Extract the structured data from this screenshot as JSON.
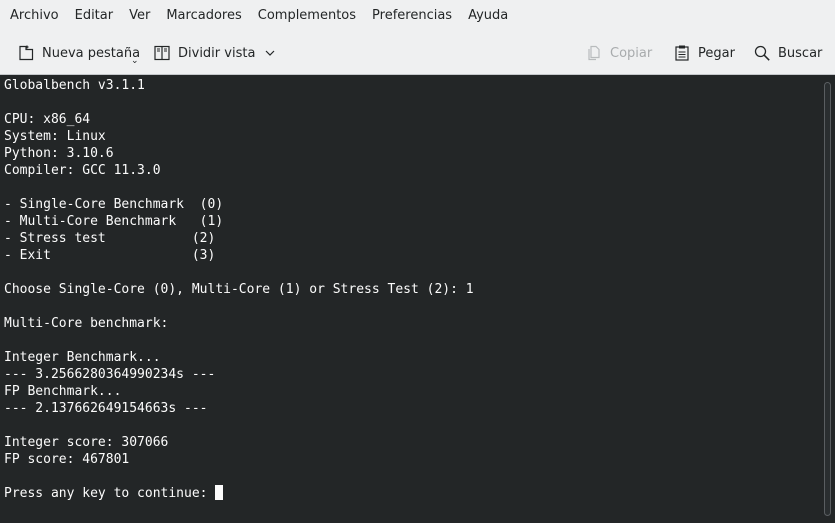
{
  "menubar": {
    "items": [
      "Archivo",
      "Editar",
      "Ver",
      "Marcadores",
      "Complementos",
      "Preferencias",
      "Ayuda"
    ]
  },
  "toolbar": {
    "new_tab_label": "Nueva pestaña",
    "split_view_label": "Dividir vista",
    "copy_label": "Copiar",
    "paste_label": "Pegar",
    "find_label": "Buscar",
    "icons": {
      "new_tab": "new-tab-icon",
      "split_view": "split-view-icon",
      "copy": "copy-icon",
      "paste": "paste-icon",
      "find": "search-icon"
    }
  },
  "terminal": {
    "lines": [
      "Globalbench v3.1.1",
      "",
      "CPU: x86_64",
      "System: Linux",
      "Python: 3.10.6",
      "Compiler: GCC 11.3.0",
      "",
      "- Single-Core Benchmark  (0)",
      "- Multi-Core Benchmark   (1)",
      "- Stress test           (2)",
      "- Exit                  (3)",
      "",
      "Choose Single-Core (0), Multi-Core (1) or Stress Test (2): 1",
      "",
      "Multi-Core benchmark:",
      "",
      "Integer Benchmark...",
      "--- 3.2566280364990234s ---",
      "FP Benchmark...",
      "--- 2.137662649154663s ---",
      "",
      "Integer score: 307066",
      "FP score: 467801",
      ""
    ],
    "prompt": "Press any key to continue: "
  },
  "colors": {
    "chrome_bg": "#eff0f1",
    "terminal_bg": "#232627",
    "terminal_fg": "#fcfcfc",
    "disabled_text": "#a8abad"
  }
}
